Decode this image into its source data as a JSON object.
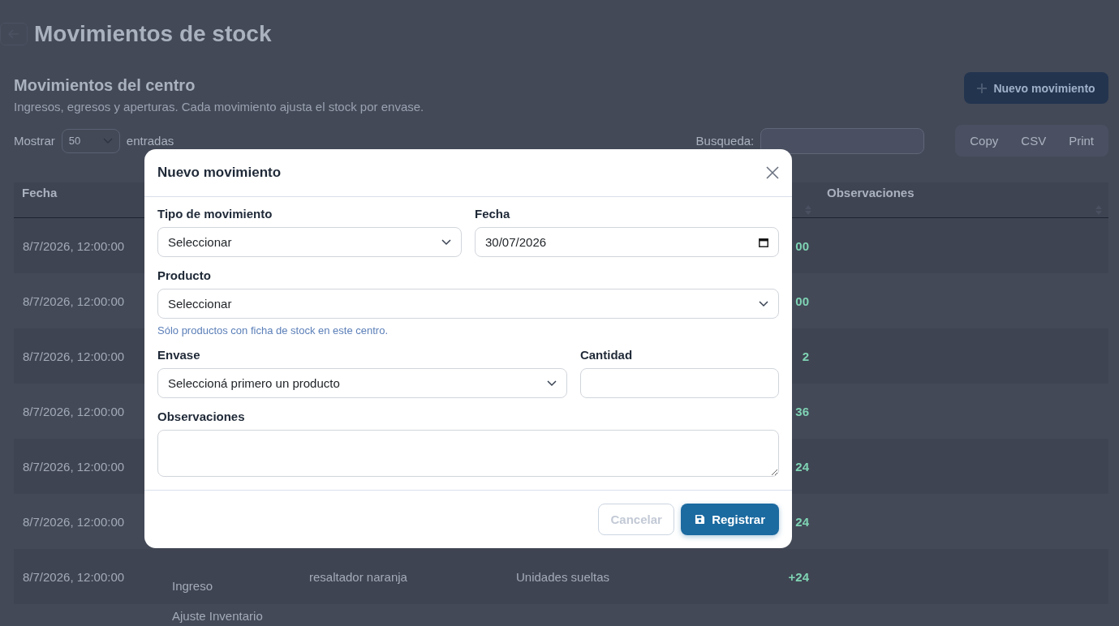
{
  "page": {
    "title": "Movimientos de stock"
  },
  "section": {
    "title": "Movimientos del centro",
    "subtitle": "Ingresos, egresos y aperturas. Cada movimiento ajusta el stock por envase.",
    "new_button": "Nuevo movimiento"
  },
  "table_controls": {
    "show_label": "Mostrar",
    "page_size": "50",
    "entries_label": "entradas",
    "search_label": "Busqueda:",
    "export_buttons": [
      "Copy",
      "CSV",
      "Print"
    ]
  },
  "table": {
    "columns": [
      {
        "label": "Fecha"
      },
      {
        "label": "Observaciones"
      }
    ],
    "rows": [
      {
        "date": "8/7/2026, 12:00:00",
        "quantity": "00"
      },
      {
        "date": "8/7/2026, 12:00:00",
        "quantity": "00"
      },
      {
        "date": "8/7/2026, 12:00:00",
        "quantity": "2"
      },
      {
        "date": "8/7/2026, 12:00:00",
        "quantity": "36"
      },
      {
        "date": "8/7/2026, 12:00:00",
        "quantity": "24"
      },
      {
        "date": "8/7/2026, 12:00:00",
        "quantity": "24"
      },
      {
        "date": "8/7/2026, 12:00:00",
        "type": "Ingreso",
        "product": "resaltador naranja",
        "container": "Unidades sueltas",
        "quantity": "+24"
      },
      {
        "type": "Ajuste Inventario"
      }
    ]
  },
  "modal": {
    "title": "Nuevo movimiento",
    "rows": [
      [
        {
          "kind": "select",
          "label": "Tipo de movimiento",
          "value": "Seleccionar"
        },
        {
          "kind": "date",
          "label": "Fecha",
          "value": "30/07/2026"
        }
      ],
      [
        {
          "kind": "select",
          "label": "Producto",
          "value": "Seleccionar",
          "hint": "Sólo productos con ficha de stock en este centro."
        }
      ],
      [
        {
          "kind": "select",
          "label": "Envase",
          "value": "Seleccioná primero un producto"
        },
        {
          "kind": "text",
          "label": "Cantidad"
        }
      ],
      [
        {
          "kind": "textarea",
          "label": "Observaciones"
        }
      ]
    ],
    "buttons": [
      {
        "kind": "secondary",
        "label": "Cancelar"
      },
      {
        "kind": "primary",
        "label": "Registrar"
      }
    ]
  }
}
